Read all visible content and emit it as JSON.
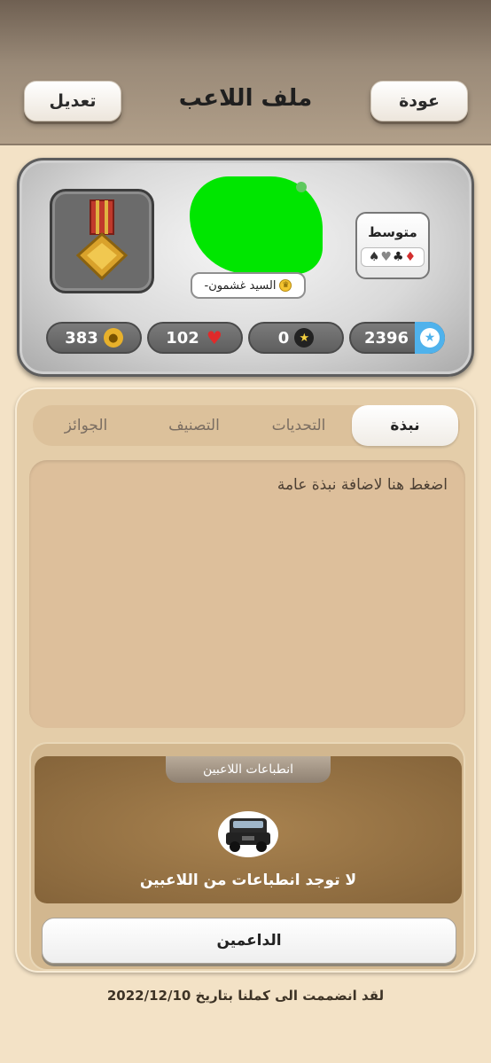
{
  "header": {
    "title": "ملف اللاعب",
    "edit_label": "تعديل",
    "back_label": "عودة"
  },
  "profile": {
    "name": "السيد غشمون-",
    "level_label": "متوسط",
    "suits": "♠♥♣♦",
    "stats": {
      "coins": "383",
      "hearts": "102",
      "stars": "0",
      "points": "2396"
    }
  },
  "tabs": [
    {
      "label": "نبذة",
      "active": true
    },
    {
      "label": "التحديات",
      "active": false
    },
    {
      "label": "التصنيف",
      "active": false
    },
    {
      "label": "الجوائز",
      "active": false
    }
  ],
  "bio": {
    "placeholder": "اضغط هنا لاضافة نبذة عامة"
  },
  "impressions": {
    "title": "انطباعات اللاعبين",
    "empty_text": "لا توجد انطباعات من اللاعبين"
  },
  "supporters_label": "الداعمين",
  "joined_text": "لقد انضممت الى كملنا بتاريخ 2022/12/10",
  "colors": {
    "panel": "#e4cda9",
    "accent_blue": "#4fb2ec",
    "impressions_bg": "#85643a"
  }
}
